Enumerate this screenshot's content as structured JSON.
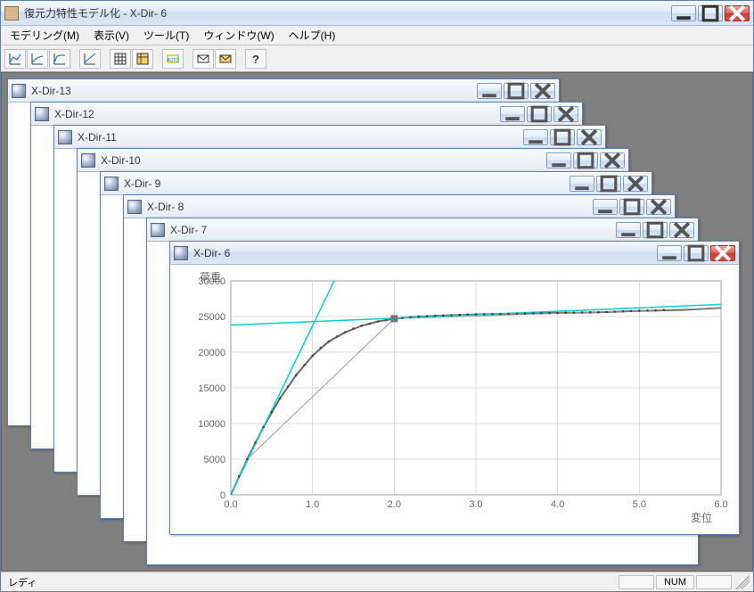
{
  "app": {
    "title": "復元力特性モデル化 - X-Dir- 6"
  },
  "menu": {
    "modeling": "モデリング(M)",
    "view": "表示(V)",
    "tool": "ツール(T)",
    "window": "ウィンドウ(W)",
    "help": "ヘルプ(H)"
  },
  "children": [
    {
      "title": "X-Dir-13"
    },
    {
      "title": "X-Dir-12"
    },
    {
      "title": "X-Dir-11"
    },
    {
      "title": "X-Dir-10"
    },
    {
      "title": "X-Dir- 9"
    },
    {
      "title": "X-Dir- 8"
    },
    {
      "title": "X-Dir- 7"
    },
    {
      "title": "X-Dir- 6"
    }
  ],
  "status": {
    "ready": "レディ",
    "num": "NUM"
  },
  "chart_data": {
    "type": "line",
    "title": "",
    "xlabel": "変位",
    "ylabel": "荷重",
    "xlim": [
      0,
      6.0
    ],
    "ylim": [
      0,
      30000
    ],
    "x_ticks": [
      "0.0",
      "1.0",
      "2.0",
      "3.0",
      "4.0",
      "5.0",
      "6.0"
    ],
    "y_ticks": [
      "0",
      "5000",
      "10000",
      "15000",
      "20000",
      "25000",
      "30000"
    ],
    "series": [
      {
        "name": "curve",
        "color": "#666666",
        "style": "solid",
        "x": [
          0.0,
          0.2,
          0.4,
          0.6,
          0.8,
          1.0,
          1.2,
          1.4,
          1.6,
          1.8,
          2.0,
          2.2,
          2.5,
          3.0,
          3.5,
          4.0,
          4.5,
          5.0,
          5.5,
          6.0
        ],
        "y": [
          0,
          5000,
          9500,
          13500,
          16800,
          19500,
          21500,
          22800,
          23700,
          24300,
          24700,
          24900,
          25100,
          25300,
          25400,
          25500,
          25600,
          25800,
          25900,
          26200
        ]
      },
      {
        "name": "trilinear",
        "color": "#999999",
        "style": "solid-thin",
        "x": [
          0.0,
          0.2,
          2.0,
          6.0
        ],
        "y": [
          0,
          5000,
          24700,
          26200
        ]
      },
      {
        "name": "asymptote-h",
        "color": "#00d0d0",
        "style": "solid",
        "x": [
          0.0,
          6.2
        ],
        "y": [
          23800,
          26800
        ]
      },
      {
        "name": "asymptote-v",
        "color": "#00d0d0",
        "style": "solid",
        "x": [
          0.0,
          1.35
        ],
        "y": [
          0,
          32000
        ]
      },
      {
        "name": "points",
        "color": "#444444",
        "style": "dots",
        "x": [
          0.0,
          0.1,
          0.2,
          0.3,
          0.4,
          0.5,
          0.6,
          0.7,
          0.8,
          0.9,
          1.0,
          1.1,
          1.2,
          1.3,
          1.4,
          1.5,
          1.6,
          1.7,
          1.8,
          1.9,
          2.0,
          2.1,
          2.2,
          2.3,
          2.4,
          2.5,
          2.6,
          2.7,
          2.8,
          2.9,
          3.0,
          3.1,
          3.2,
          3.3,
          3.4,
          3.5,
          3.6,
          3.7,
          3.8,
          3.9,
          4.0,
          4.1,
          4.2,
          4.3,
          4.4,
          4.5,
          4.6,
          4.7,
          4.8,
          4.9,
          5.0,
          5.1,
          5.2,
          5.3
        ],
        "y": [
          0,
          2600,
          5000,
          7300,
          9500,
          11600,
          13500,
          15200,
          16800,
          18200,
          19500,
          20600,
          21500,
          22200,
          22800,
          23300,
          23700,
          24000,
          24300,
          24500,
          24700,
          24800,
          24900,
          25000,
          25050,
          25100,
          25150,
          25200,
          25240,
          25280,
          25300,
          25320,
          25340,
          25360,
          25380,
          25400,
          25420,
          25440,
          25460,
          25480,
          25500,
          25520,
          25540,
          25560,
          25580,
          25600,
          25640,
          25680,
          25720,
          25760,
          25800,
          25830,
          25860,
          25900
        ]
      }
    ],
    "marker": {
      "x": 2.0,
      "y": 24700
    }
  }
}
